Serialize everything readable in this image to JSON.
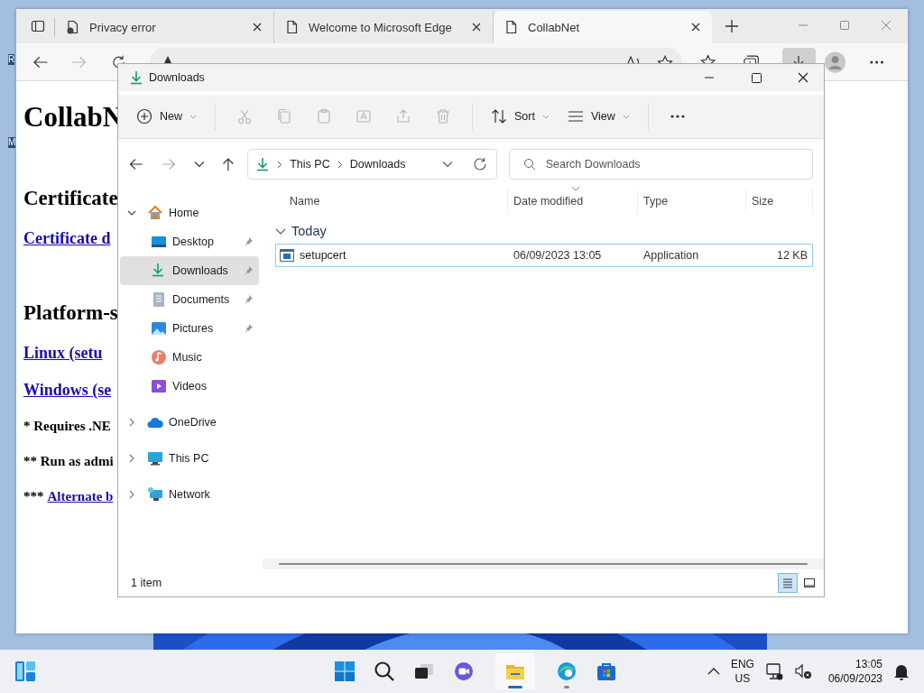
{
  "desktop": {
    "icon_labels": [
      "R",
      "M"
    ]
  },
  "browser": {
    "tabs": [
      {
        "title": "Privacy error",
        "selected": false
      },
      {
        "title": "Welcome to Microsoft Edge",
        "selected": false
      },
      {
        "title": "CollabNet",
        "selected": true
      }
    ],
    "forward_disabled": true,
    "downloads_open": true,
    "page": {
      "heading": "CollabN",
      "blocks": [
        {
          "kind": "h2",
          "text": "Certificate"
        },
        {
          "kind": "link",
          "text": "Certificate d"
        },
        {
          "kind": "h2",
          "text": "Platform-s"
        },
        {
          "kind": "link",
          "text": "Linux (setu"
        },
        {
          "kind": "link",
          "text": "Windows (se"
        },
        {
          "kind": "note",
          "text": "* Requires .NE"
        },
        {
          "kind": "note",
          "text": "** Run as admi"
        },
        {
          "kind": "note_link",
          "prefix": "***",
          "text": "Alternate b"
        }
      ]
    }
  },
  "explorer": {
    "title": "Downloads",
    "new_label": "New",
    "actions": [
      {
        "disabled": true
      },
      {
        "disabled": true
      },
      {
        "disabled": true
      },
      {
        "disabled": true
      },
      {
        "disabled": true
      },
      {
        "disabled": true
      }
    ],
    "sort_label": "Sort",
    "view_label": "View",
    "forward_disabled": true,
    "breadcrumb": [
      "This PC",
      "Downloads"
    ],
    "search": {
      "placeholder": "Search Downloads"
    },
    "columns": [
      "Name",
      "Date modified",
      "Type",
      "Size"
    ],
    "groups": [
      {
        "label": "Today",
        "expanded": true,
        "rows": [
          {
            "name": "setupcert",
            "date": "06/09/2023 13:05",
            "type": "Application",
            "size": "12 KB",
            "selected": true
          }
        ]
      }
    ],
    "nav_pane": [
      {
        "label": "Home",
        "kind": "home",
        "expanded": true,
        "children": [
          {
            "label": "Desktop",
            "kind": "desktop",
            "pinned": true,
            "selected": false
          },
          {
            "label": "Downloads",
            "kind": "downloads",
            "pinned": true,
            "selected": true
          },
          {
            "label": "Documents",
            "kind": "documents",
            "pinned": true,
            "selected": false
          },
          {
            "label": "Pictures",
            "kind": "pictures",
            "pinned": true,
            "selected": false
          },
          {
            "label": "Music",
            "kind": "music",
            "pinned": false,
            "selected": false
          },
          {
            "label": "Videos",
            "kind": "videos",
            "pinned": false,
            "selected": false
          }
        ]
      },
      {
        "label": "OneDrive",
        "kind": "cloud",
        "expanded": false
      },
      {
        "label": "This PC",
        "kind": "pc",
        "expanded": false
      },
      {
        "label": "Network",
        "kind": "network",
        "expanded": false
      }
    ],
    "status": "1 item",
    "view_buttons": [
      {
        "selected": true
      },
      {
        "selected": false
      }
    ]
  },
  "taskbar": {
    "apps": [
      {
        "kind": "start",
        "open": false,
        "focused": false
      },
      {
        "kind": "search",
        "open": false,
        "focused": false
      },
      {
        "kind": "taskview",
        "open": false,
        "focused": false
      },
      {
        "kind": "chat",
        "open": false,
        "focused": false
      },
      {
        "kind": "explorer",
        "open": true,
        "focused": true
      },
      {
        "kind": "edge",
        "open": true,
        "focused": false
      },
      {
        "kind": "store",
        "open": false,
        "focused": false
      }
    ],
    "tray": {
      "language": "ENG",
      "region": "US",
      "time": "13:05",
      "date": "06/09/2023"
    }
  }
}
